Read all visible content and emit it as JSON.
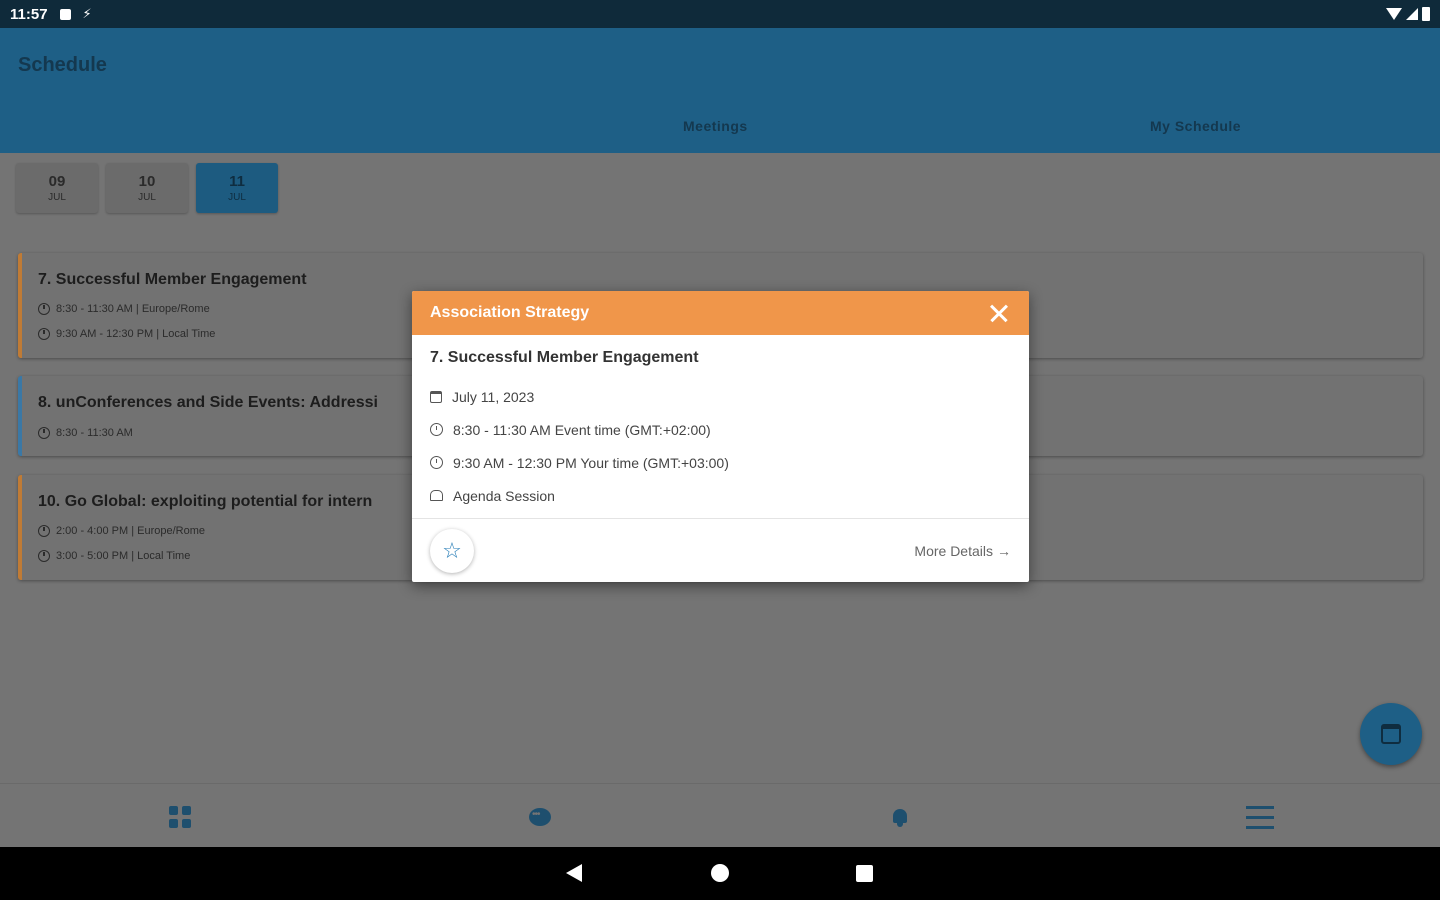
{
  "status_bar": {
    "time": "11:57"
  },
  "header": {
    "title": "Schedule",
    "tabs": [
      {
        "label": "Meetings"
      },
      {
        "label": "My Schedule"
      }
    ]
  },
  "dates": [
    {
      "day": "09",
      "month": "JUL",
      "active": false
    },
    {
      "day": "10",
      "month": "JUL",
      "active": false
    },
    {
      "day": "11",
      "month": "JUL",
      "active": true
    }
  ],
  "sessions": [
    {
      "title": "7. Successful Member Engagement",
      "lines": [
        "8:30 - 11:30 AM | Europe/Rome",
        "9:30 AM - 12:30 PM | Local Time"
      ],
      "accent": "#e8913a"
    },
    {
      "title": "8. unConferences and Side Events: Addressi",
      "lines": [
        "8:30 - 11:30 AM"
      ],
      "accent": "#3b8fcf"
    },
    {
      "title": "10. Go Global: exploiting potential for intern",
      "lines": [
        "2:00 - 4:00 PM | Europe/Rome",
        "3:00 - 5:00 PM | Local Time"
      ],
      "accent": "#e8913a"
    }
  ],
  "modal": {
    "category": "Association Strategy",
    "title": "7. Successful Member Engagement",
    "date": "July 11, 2023",
    "event_time": "8:30 - 11:30 AM Event time (GMT:+02:00)",
    "your_time": "9:30 AM - 12:30 PM Your time (GMT:+03:00)",
    "session_type": "Agenda Session",
    "more_details_label": "More Details",
    "header_color": "#f0964a"
  },
  "icons": {
    "close": "close-icon",
    "favorite": "star-outline-icon",
    "fab": "calendar-icon",
    "nav": [
      "grid-icon",
      "chat-icon",
      "bell-icon",
      "menu-icon"
    ]
  }
}
